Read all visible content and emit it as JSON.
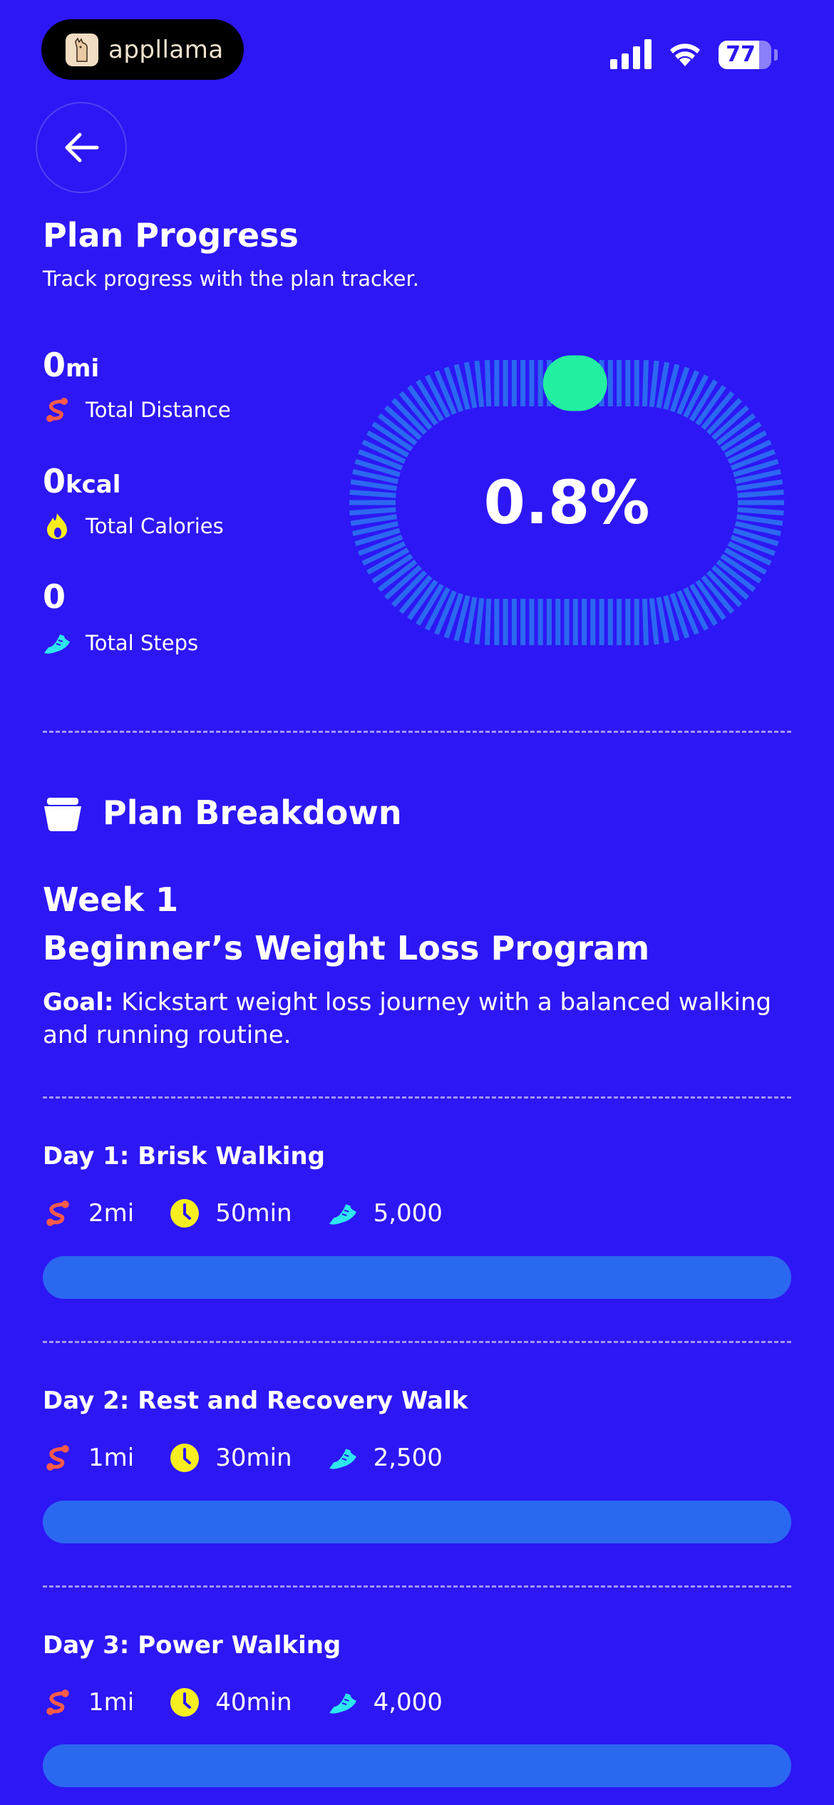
{
  "status_bar": {
    "brand": "appllama",
    "battery": "77",
    "battery_level": 0.77
  },
  "header": {
    "title": "Plan Progress",
    "subtitle": "Track progress with the plan tracker."
  },
  "stats": {
    "distance": {
      "value": "0",
      "unit": "mi",
      "label": "Total Distance",
      "icon": "route-icon"
    },
    "calories": {
      "value": "0",
      "unit": "kcal",
      "label": "Total Calories",
      "icon": "flame-icon"
    },
    "steps": {
      "value": "0",
      "unit": "",
      "label": "Total Steps",
      "icon": "shoe-icon"
    }
  },
  "progress_ring": {
    "percent_label": "0.8%",
    "value": 0.008
  },
  "breakdown": {
    "title": "Plan Breakdown",
    "week": "Week 1",
    "program": "Beginner’s Weight Loss Program",
    "goal_label": "Goal:",
    "goal_text": " Kickstart weight loss journey with a balanced walking and running routine."
  },
  "days": [
    {
      "title": "Day 1: Brisk Walking",
      "distance": "2mi",
      "duration": "50min",
      "steps": "5,000",
      "progress": 0
    },
    {
      "title": "Day 2: Rest and Recovery Walk",
      "distance": "1mi",
      "duration": "30min",
      "steps": "2,500",
      "progress": 0
    },
    {
      "title": "Day 3: Power Walking",
      "distance": "1mi",
      "duration": "40min",
      "steps": "4,000",
      "progress": 0
    }
  ],
  "colors": {
    "background": "#2d17f4",
    "track": "#2b68f0",
    "accent_green": "#22f0a0",
    "route_red": "#ff5b4a",
    "clock_yellow": "#f6ee1e",
    "shoe_cyan": "#2ee6f0"
  }
}
